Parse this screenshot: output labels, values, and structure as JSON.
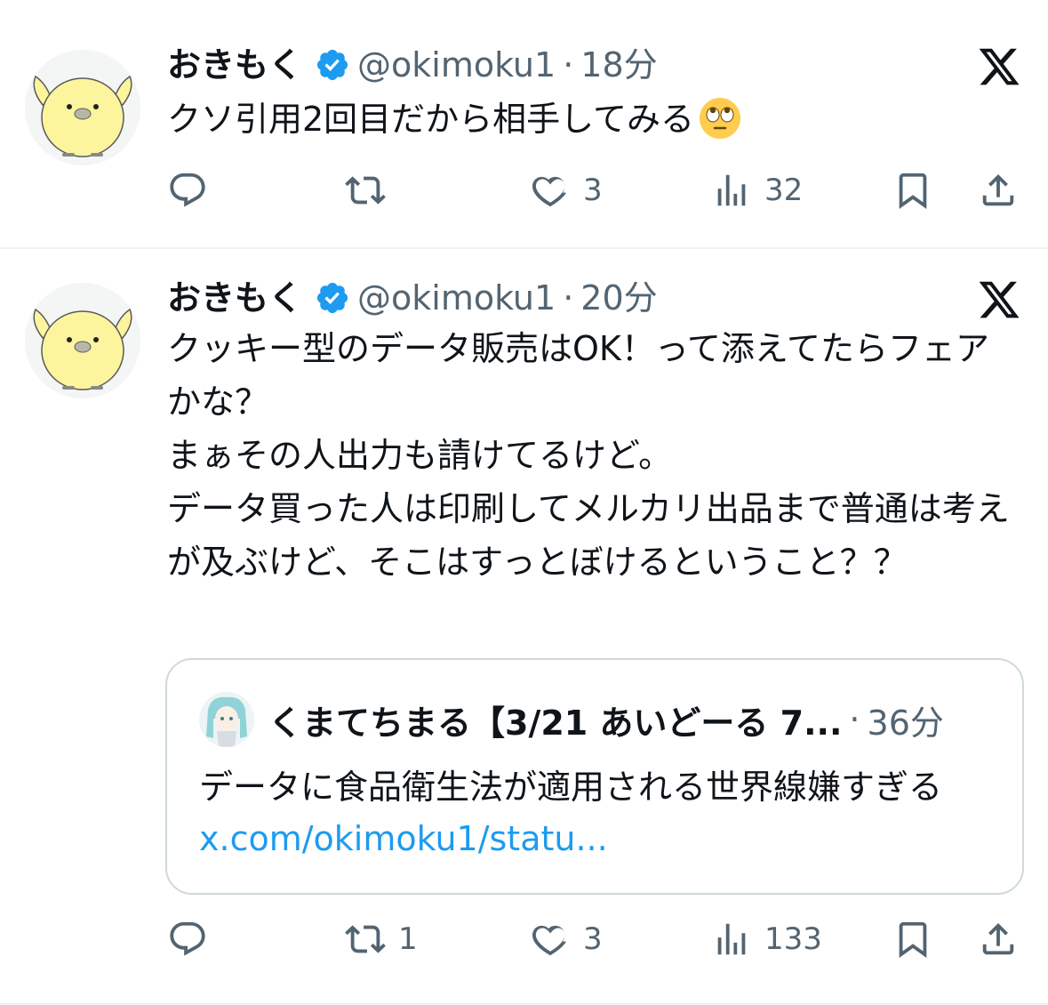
{
  "tweets": [
    {
      "name": "おきもく",
      "handle": "@okimoku1",
      "separator": "·",
      "time": "18分",
      "text": "クソ引用2回目だから相手してみる",
      "emoji": "face-with-rolling-eyes",
      "actions": {
        "reply_count": "",
        "retweet_count": "",
        "like_count": "3",
        "views_count": "32"
      }
    },
    {
      "name": "おきもく",
      "handle": "@okimoku1",
      "separator": "·",
      "time": "20分",
      "text": "クッキー型のデータ販売はOK！って添えてたらフェアかな？\nまぁその人出力も請けてるけど。\nデータ買った人は印刷してメルカリ出品まで普通は考えが及ぶけど、そこはすっとぼけるということ？？",
      "actions": {
        "reply_count": "",
        "retweet_count": "1",
        "like_count": "3",
        "views_count": "133"
      },
      "quote": {
        "name": "くまてちまる【3/21 あいどーる 7...",
        "separator": "·",
        "time": "36分",
        "text": "データに食品衛生法が適用される世界線嫌すぎる",
        "link": "x.com/okimoku1/statu..."
      }
    }
  ],
  "colors": {
    "text": "#0f1419",
    "secondary": "#536471",
    "link": "#1d9bf0",
    "verified": "#1d9bf0",
    "divider": "#eff3f4",
    "quote_border": "#cfd9de"
  },
  "icons": [
    "x-logo-icon",
    "verified-badge-icon",
    "reply-icon",
    "retweet-icon",
    "like-icon",
    "views-icon",
    "bookmark-icon",
    "share-icon"
  ]
}
